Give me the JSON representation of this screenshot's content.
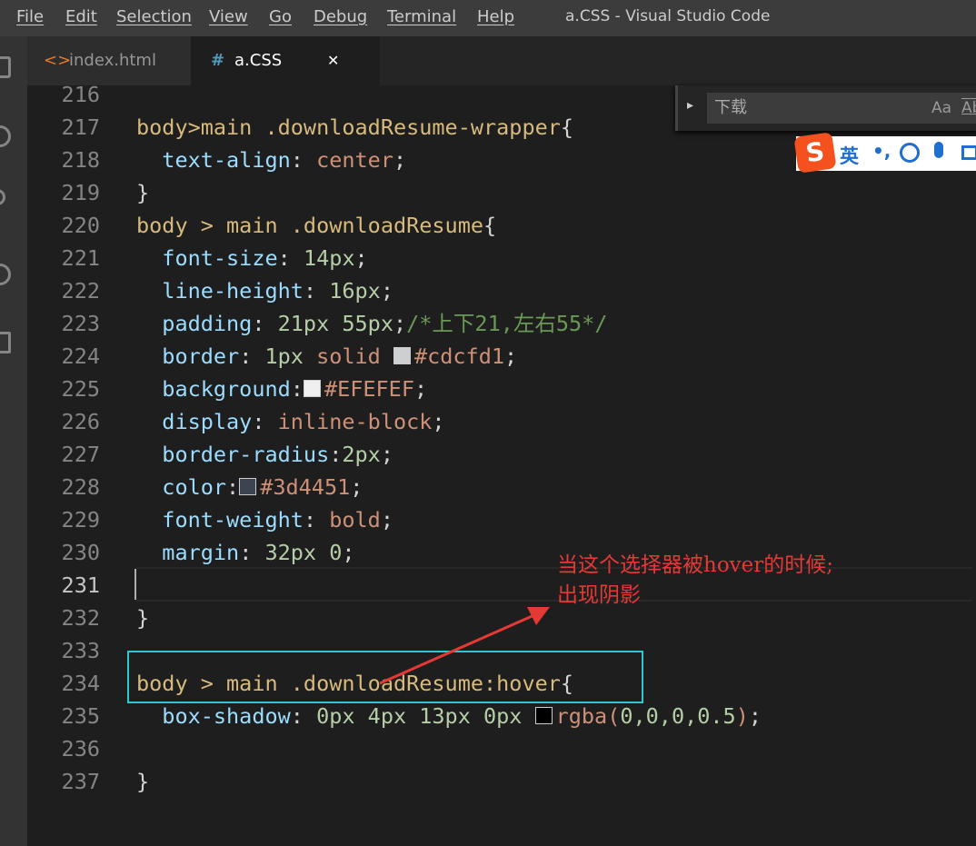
{
  "menu": [
    "File",
    "Edit",
    "Selection",
    "View",
    "Go",
    "Debug",
    "Terminal",
    "Help"
  ],
  "title": "a.CSS - Visual Studio Code",
  "tabs": [
    {
      "label": "index.html",
      "icon": "<>"
    },
    {
      "label": "a.CSS",
      "icon": "#",
      "close": "✕"
    }
  ],
  "find": {
    "value": "下载",
    "case": "Aa",
    "word": "Ab"
  },
  "ime": {
    "logo": "S",
    "mode": "英",
    "punct": "•,"
  },
  "annotation": {
    "line1": "当这个选择器被hover的时候;",
    "line2": "出现阴影"
  },
  "colors": {
    "selector": "#d7ba7d",
    "property": "#9cdcfe",
    "value": "#ce9178",
    "number": "#b5cea8",
    "comment": "#6a9955",
    "annotation": "#e53935",
    "highlight_box": "#2ec8d0"
  },
  "lines": [
    {
      "n": "216",
      "t": []
    },
    {
      "n": "217",
      "t": [
        [
          "sel",
          "body>main .downloadResume-wrapper"
        ],
        [
          "pun",
          "{"
        ]
      ]
    },
    {
      "n": "218",
      "t": [
        [
          "pun",
          "  "
        ],
        [
          "prop",
          "text-align"
        ],
        [
          "pun",
          ": "
        ],
        [
          "val",
          "center"
        ],
        [
          "pun",
          ";"
        ]
      ]
    },
    {
      "n": "219",
      "t": [
        [
          "pun",
          "}"
        ]
      ]
    },
    {
      "n": "220",
      "t": [
        [
          "sel",
          "body > main .downloadResume"
        ],
        [
          "pun",
          "{"
        ]
      ]
    },
    {
      "n": "221",
      "t": [
        [
          "pun",
          "  "
        ],
        [
          "prop",
          "font-size"
        ],
        [
          "pun",
          ": "
        ],
        [
          "num",
          "14px"
        ],
        [
          "pun",
          ";"
        ]
      ]
    },
    {
      "n": "222",
      "t": [
        [
          "pun",
          "  "
        ],
        [
          "prop",
          "line-height"
        ],
        [
          "pun",
          ": "
        ],
        [
          "num",
          "16px"
        ],
        [
          "pun",
          ";"
        ]
      ]
    },
    {
      "n": "223",
      "t": [
        [
          "pun",
          "  "
        ],
        [
          "prop",
          "padding"
        ],
        [
          "pun",
          ": "
        ],
        [
          "num",
          "21px 55px"
        ],
        [
          "pun",
          ";"
        ],
        [
          "com",
          "/*上下21,左右55*/"
        ]
      ]
    },
    {
      "n": "224",
      "t": [
        [
          "pun",
          "  "
        ],
        [
          "prop",
          "border"
        ],
        [
          "pun",
          ": "
        ],
        [
          "num",
          "1px "
        ],
        [
          "val",
          "solid "
        ],
        [
          "sw",
          "#cdcfd1"
        ],
        [
          "val",
          "#cdcfd1"
        ],
        [
          "pun",
          ";"
        ]
      ]
    },
    {
      "n": "225",
      "t": [
        [
          "pun",
          "  "
        ],
        [
          "prop",
          "background"
        ],
        [
          "pun",
          ":"
        ],
        [
          "sw",
          "#EFEFEF"
        ],
        [
          "val",
          "#EFEFEF"
        ],
        [
          "pun",
          ";"
        ]
      ]
    },
    {
      "n": "226",
      "t": [
        [
          "pun",
          "  "
        ],
        [
          "prop",
          "display"
        ],
        [
          "pun",
          ": "
        ],
        [
          "val",
          "inline-block"
        ],
        [
          "pun",
          ";"
        ]
      ]
    },
    {
      "n": "227",
      "t": [
        [
          "pun",
          "  "
        ],
        [
          "prop",
          "border-radius"
        ],
        [
          "pun",
          ":"
        ],
        [
          "num",
          "2px"
        ],
        [
          "pun",
          ";"
        ]
      ]
    },
    {
      "n": "228",
      "t": [
        [
          "pun",
          "  "
        ],
        [
          "prop",
          "color"
        ],
        [
          "pun",
          ":"
        ],
        [
          "sw",
          "#3d4451"
        ],
        [
          "val",
          "#3d4451"
        ],
        [
          "pun",
          ";"
        ]
      ]
    },
    {
      "n": "229",
      "t": [
        [
          "pun",
          "  "
        ],
        [
          "prop",
          "font-weight"
        ],
        [
          "pun",
          ": "
        ],
        [
          "val",
          "bold"
        ],
        [
          "pun",
          ";"
        ]
      ]
    },
    {
      "n": "230",
      "t": [
        [
          "pun",
          "  "
        ],
        [
          "prop",
          "margin"
        ],
        [
          "pun",
          ": "
        ],
        [
          "num",
          "32px 0"
        ],
        [
          "pun",
          ";"
        ]
      ]
    },
    {
      "n": "231",
      "t": []
    },
    {
      "n": "232",
      "t": [
        [
          "pun",
          "}"
        ]
      ]
    },
    {
      "n": "233",
      "t": []
    },
    {
      "n": "234",
      "t": [
        [
          "sel",
          "body > main .downloadResume:hover"
        ],
        [
          "pun",
          "{"
        ]
      ]
    },
    {
      "n": "235",
      "t": [
        [
          "pun",
          "  "
        ],
        [
          "prop",
          "box-shadow"
        ],
        [
          "pun",
          ": "
        ],
        [
          "num",
          "0px 4px 13px 0px "
        ],
        [
          "sw",
          "rgba(0,0,0,0.5)"
        ],
        [
          "val",
          "rgba("
        ],
        [
          "num",
          "0,0,0,0.5"
        ],
        [
          "val",
          ")"
        ],
        [
          "pun",
          ";"
        ]
      ]
    },
    {
      "n": "236",
      "t": []
    },
    {
      "n": "237",
      "t": [
        [
          "pun",
          "}"
        ]
      ]
    }
  ]
}
